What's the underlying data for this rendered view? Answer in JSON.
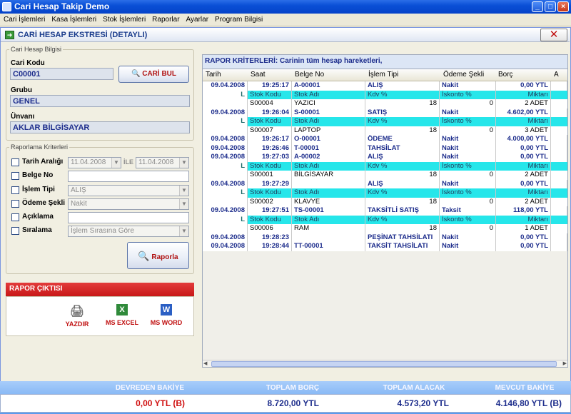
{
  "window": {
    "title": "Cari Hesap Takip Demo"
  },
  "menu": [
    "Cari İşlemleri",
    "Kasa İşlemleri",
    "Stok İşlemleri",
    "Raporlar",
    "Ayarlar",
    "Program Bilgisi"
  ],
  "form": {
    "title": "CARİ HESAP EKSTRESİ (DETAYLI)"
  },
  "cari": {
    "legend": "Cari Hesap Bilgisi",
    "kod_label": "Cari Kodu",
    "kod": "C00001",
    "bul_label": "CARİ BUL",
    "grup_label": "Grubu",
    "grup": "GENEL",
    "unvan_label": "Ünvanı",
    "unvan": "AKLAR BİLGİSAYAR"
  },
  "kriter": {
    "legend": "Raporlama Kriterleri",
    "tarih_label": "Tarih Aralığı",
    "tarih1": "11.04.2008",
    "ile": "İLE",
    "tarih2": "11.04.2008",
    "belge_label": "Belge No",
    "islem_label": "İşlem Tipi",
    "islem": "ALIŞ",
    "odeme_label": "Ödeme Şekli",
    "odeme": "Nakit",
    "aciklama_label": "Açıklama",
    "siralama_label": "Sıralama",
    "siralama": "İşlem Sırasına Göre",
    "raporla_label": "Raporla"
  },
  "output": {
    "title": "RAPOR ÇIKTISI",
    "yazdir": "YAZDIR",
    "excel": "MS EXCEL",
    "word": "MS WORD"
  },
  "grid": {
    "criteria": "RAPOR KRİTERLERİ: Carinin tüm hesap hareketleri,",
    "headers": [
      "Tarih",
      "Saat",
      "Belge No",
      "İşlem Tipi",
      "Ödeme Şekli",
      "Borç",
      "A"
    ],
    "rows": [
      {
        "t": "main",
        "c": [
          "09.04.2008",
          "19:25:17",
          "A-00001",
          "ALIŞ",
          "Nakit",
          "0,00 YTL"
        ]
      },
      {
        "t": "sub",
        "c": [
          "L",
          "Stok Kodu",
          "Stok Adı",
          "Kdv %",
          "İskonto %",
          "Miktarı"
        ]
      },
      {
        "t": "det",
        "c": [
          "",
          "S00004",
          "YAZICI",
          "18",
          "0",
          "2 ADET"
        ]
      },
      {
        "t": "main",
        "c": [
          "09.04.2008",
          "19:26:04",
          "S-00001",
          "SATIŞ",
          "Nakit",
          "4.602,00 YTL"
        ]
      },
      {
        "t": "sub",
        "c": [
          "L",
          "Stok Kodu",
          "Stok Adı",
          "Kdv %",
          "İskonto %",
          "Miktarı"
        ]
      },
      {
        "t": "det",
        "c": [
          "",
          "S00007",
          "LAPTOP",
          "18",
          "0",
          "3 ADET"
        ]
      },
      {
        "t": "main",
        "c": [
          "09.04.2008",
          "19:26:17",
          "O-00001",
          "ÖDEME",
          "Nakit",
          "4.000,00 YTL"
        ]
      },
      {
        "t": "main",
        "c": [
          "09.04.2008",
          "19:26:46",
          "T-00001",
          "TAHSİLAT",
          "Nakit",
          "0,00 YTL"
        ]
      },
      {
        "t": "main",
        "c": [
          "09.04.2008",
          "19:27:03",
          "A-00002",
          "ALIŞ",
          "Nakit",
          "0,00 YTL"
        ]
      },
      {
        "t": "sub",
        "c": [
          "L",
          "Stok Kodu",
          "Stok Adı",
          "Kdv %",
          "İskonto %",
          "Miktarı"
        ]
      },
      {
        "t": "det",
        "c": [
          "",
          "S00001",
          "BİLGİSAYAR",
          "18",
          "0",
          "2 ADET"
        ]
      },
      {
        "t": "main",
        "c": [
          "09.04.2008",
          "19:27:29",
          "",
          "ALIŞ",
          "Nakit",
          "0,00 YTL"
        ]
      },
      {
        "t": "sub",
        "c": [
          "L",
          "Stok Kodu",
          "Stok Adı",
          "Kdv %",
          "İskonto %",
          "Miktarı"
        ]
      },
      {
        "t": "det",
        "c": [
          "",
          "S00002",
          "KLAVYE",
          "18",
          "0",
          "2 ADET"
        ]
      },
      {
        "t": "main",
        "c": [
          "09.04.2008",
          "19:27:51",
          "TS-00001",
          "TAKSİTLİ SATIŞ",
          "Taksit",
          "118,00 YTL"
        ]
      },
      {
        "t": "sub",
        "c": [
          "L",
          "Stok Kodu",
          "Stok Adı",
          "Kdv %",
          "İskonto %",
          "Miktarı"
        ]
      },
      {
        "t": "det",
        "c": [
          "",
          "S00006",
          "RAM",
          "18",
          "0",
          "1 ADET"
        ]
      },
      {
        "t": "main",
        "c": [
          "09.04.2008",
          "19:28:23",
          "",
          "PEŞİNAT TAHSİLATI",
          "Nakit",
          "0,00 YTL"
        ]
      },
      {
        "t": "main",
        "c": [
          "09.04.2008",
          "19:28:44",
          "TT-00001",
          "TAKSİT TAHSİLATI",
          "Nakit",
          "0,00 YTL"
        ]
      }
    ]
  },
  "totals": {
    "devreden_label": "DEVREDEN BAKİYE",
    "devreden": "0,00 YTL  (B)",
    "borc_label": "TOPLAM BORÇ",
    "borc": "8.720,00 YTL",
    "alacak_label": "TOPLAM ALACAK",
    "alacak": "4.573,20 YTL",
    "mevcut_label": "MEVCUT BAKİYE",
    "mevcut": "4.146,80 YTL  (B)"
  }
}
